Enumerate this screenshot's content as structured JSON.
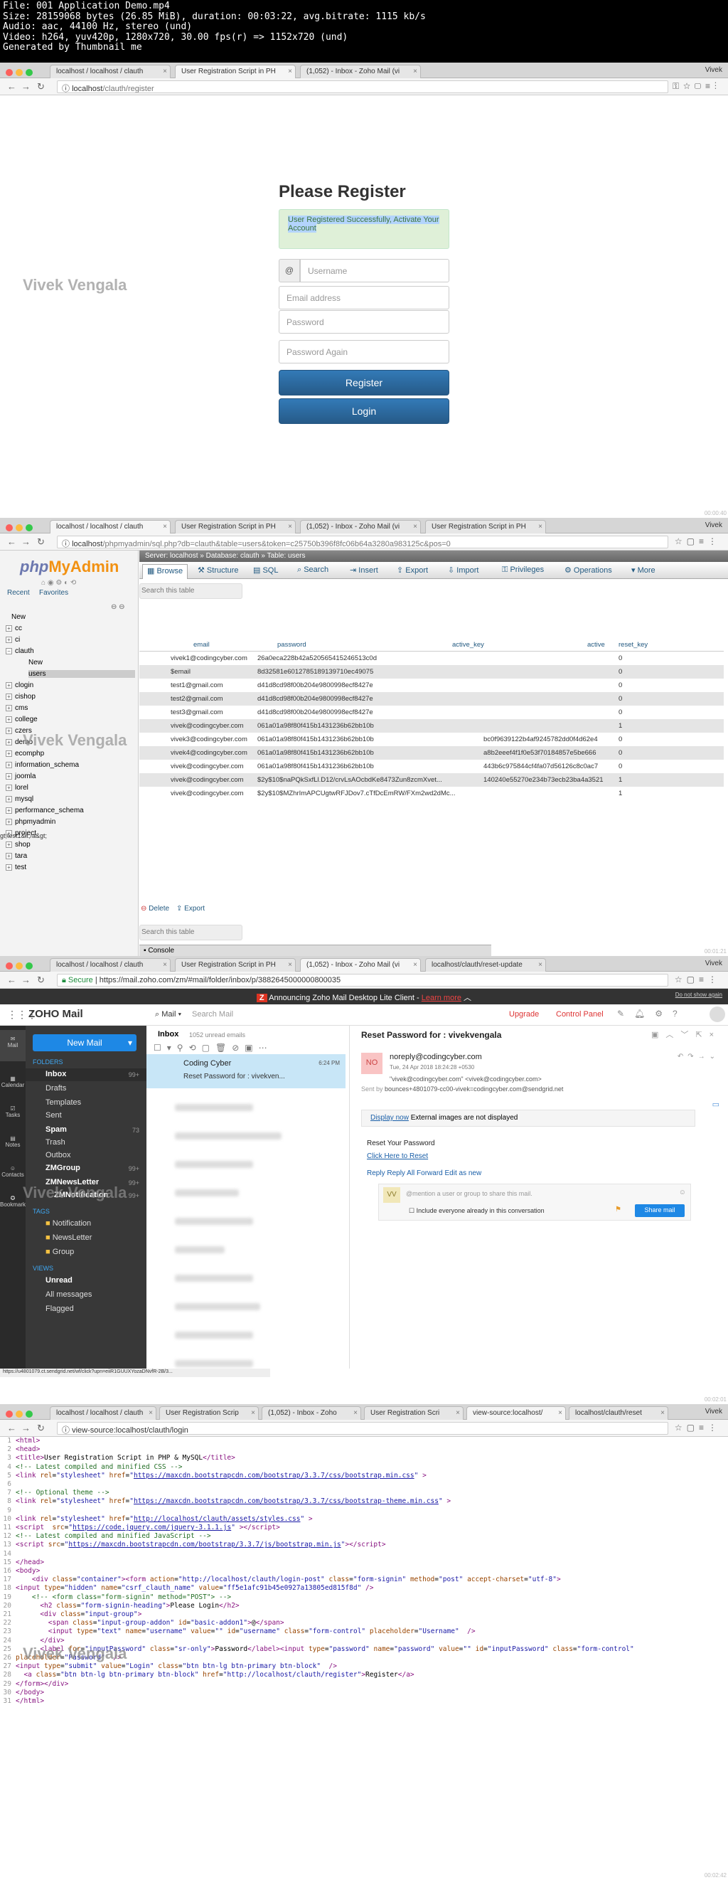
{
  "header": {
    "lines": [
      "File: 001 Application Demo.mp4",
      "Size: 28159068 bytes (26.85 MiB), duration: 00:03:22, avg.bitrate: 1115 kb/s",
      "Audio: aac, 44100 Hz, stereo (und)",
      "Video: h264, yuv420p, 1280x720, 30.00 fps(r) => 1152x720 (und)",
      "Generated by Thumbnail me"
    ]
  },
  "watermark": "Vivek Vengala",
  "user_name": "Vivek",
  "frame1": {
    "tabs": [
      "localhost / localhost / clauth",
      "User Registration Script in PH",
      "(1,052) - Inbox - Zoho Mail (vi"
    ],
    "url_host": "localhost",
    "url_path": "/clauth/register",
    "title": "Please Register",
    "alert": "User Registered Successfully, Activate Your Account",
    "addon": "@",
    "placeholders": {
      "username": "Username",
      "email": "Email address",
      "password": "Password",
      "password_again": "Password Again"
    },
    "register_btn": "Register",
    "login_btn": "Login",
    "timestamp": "00:00:40"
  },
  "frame2": {
    "tabs": [
      "localhost / localhost / clauth",
      "User Registration Script in PH",
      "(1,052) - Inbox - Zoho Mail (vi",
      "User Registration Script in PH"
    ],
    "url_host": "localhost",
    "url_path": "/phpmyadmin/sql.php?db=clauth&table=users&token=c25750b396f8fc06b64a3280a983125c&pos=0",
    "logo_php": "php",
    "logo_my": "MyAdmin",
    "recent": "Recent",
    "favorites": "Favorites",
    "breadcrumb": "Server: localhost »  Database: clauth »  Table: users",
    "tabs_pma": [
      "Browse",
      "Structure",
      "SQL",
      "Search",
      "Insert",
      "Export",
      "Import",
      "Privileges",
      "Operations",
      "More"
    ],
    "search_placeholder": "Search this table",
    "search_placeholder2": "Search this table",
    "databases": [
      "New",
      "cc",
      "ci",
      "clauth",
      "New",
      "users",
      "clogin",
      "cishop",
      "cms",
      "college",
      "czers",
      "demo",
      "ecomphp",
      "information_schema",
      "joomla",
      "lorel",
      "mysql",
      "performance_schema",
      "phpmyadmin",
      "project",
      "shop",
      "tara",
      "test"
    ],
    "columns": [
      "email",
      "password",
      "active_key",
      "active",
      "reset_key"
    ],
    "rows": [
      [
        "vivek1@codingcyber.com",
        "26a0eca228b42a520565415246513c0d",
        "",
        "0",
        ""
      ],
      [
        "$email",
        "8d32581e6012785189139710ec49075",
        "",
        "0",
        ""
      ],
      [
        "test1@gmail.com",
        "d41d8cd98f00b204e9800998ecf8427e",
        "",
        "0",
        ""
      ],
      [
        "test2@gmail.com",
        "d41d8cd98f00b204e9800998ecf8427e",
        "",
        "0",
        ""
      ],
      [
        "test3@gmail.com",
        "d41d8cd98f00b204e9800998ecf8427e",
        "",
        "0",
        ""
      ],
      [
        "vivek@codingcyber.com",
        "061a01a98f80f415b1431236b62bb10b",
        "",
        "1",
        ""
      ],
      [
        "vivek3@codingcyber.com",
        "061a01a98f80f415b1431236b62bb10b",
        "bc0f9639122b4af9245782dd0f4d62e4",
        "0",
        ""
      ],
      [
        "vivek4@codingcyber.com",
        "061a01a98f80f415b1431236b62bb10b",
        "a8b2eeef4f1f0e53f70184857e5be666",
        "0",
        ""
      ],
      [
        "vivek@codingcyber.com",
        "061a01a98f80f415b1431236b62bb10b",
        "443b6c975844cf4fa07d56126c8c0ac7",
        "0",
        ""
      ],
      [
        "vivek@codingcyber.com",
        "$2y$10$naPQkSxfLl.D12/crvLsAOcbdKe8473Zun8zcmXvet...",
        "140240e55270e234b73ecb23ba4a3521",
        "1",
        ""
      ],
      [
        "vivek@codingcyber.com",
        "$2y$10$MZhrImAPCUgtwRFJDov7.cTfDcEmRW/FXm2wd2dMc...",
        "",
        "1",
        ""
      ]
    ],
    "left_fragment": "gt;test1&lt;/a&gt;",
    "delete": "Delete",
    "export": "Export",
    "console": "Console",
    "timestamp": "00:01:21"
  },
  "frame3": {
    "tabs": [
      "localhost / localhost / clauth",
      "User Registration Script in PH",
      "(1,052) - Inbox - Zoho Mail (vi",
      "localhost/clauth/reset-update"
    ],
    "url_secure": "Secure",
    "url_path": "https://mail.zoho.com/zm/#mail/folder/inbox/p/3882645000000800035",
    "banner": "Announcing Zoho Mail Desktop Lite Client -",
    "banner_link": "Learn more",
    "banner_right": "Do not show again",
    "brand": "ZOHO Mail",
    "mail_menu": "Mail",
    "search": "Search Mail",
    "upgrade": "Upgrade",
    "control_panel": "Control Panel",
    "new_mail": "New Mail",
    "folders_title": "FOLDERS",
    "folders": [
      {
        "name": "Inbox",
        "count": "99+"
      },
      {
        "name": "Drafts",
        "count": ""
      },
      {
        "name": "Templates",
        "count": ""
      },
      {
        "name": "Sent",
        "count": ""
      },
      {
        "name": "Spam",
        "count": "73"
      },
      {
        "name": "Trash",
        "count": ""
      },
      {
        "name": "Outbox",
        "count": ""
      },
      {
        "name": "ZMGroup",
        "count": "99+"
      },
      {
        "name": "ZMNewsLetter",
        "count": "99+"
      },
      {
        "name": "ZMNotification",
        "count": "99+"
      }
    ],
    "tags_title": "TAGS",
    "tags": [
      "Notification",
      "NewsLetter",
      "Group"
    ],
    "views_title": "VIEWS",
    "views": [
      "Unread",
      "All messages",
      "Flagged"
    ],
    "left_nav": [
      "Mail",
      "Calendar",
      "Tasks",
      "Notes",
      "Contacts",
      "Bookmarks"
    ],
    "inbox_label": "Inbox",
    "unread": "1052 unread emails",
    "list_sender": "Coding Cyber",
    "list_time": "6:24 PM",
    "list_subject": "Reset Password for : vivekven...",
    "subject": "Reset Password for : vivekvengala",
    "avatar": "NO",
    "from": "noreply@codingcyber.com",
    "date": "Tue, 24 Apr 2018 18:24:28 +0530",
    "to": "\"vivek@codingcyber.com\" <vivek@codingcyber.com>",
    "sent_by_label": "Sent by",
    "sent_by": "bounces+4801079-cc00-vivek=codingcyber.com@sendgrid.net",
    "display_now": "Display now",
    "external_images": "External images are not displayed",
    "body_title": "Reset Your Password",
    "body_link": "Click Here to Reset",
    "actions": [
      "Reply",
      "Reply All",
      "Forward",
      "Edit as new"
    ],
    "reply_avatar": "VV",
    "mention_placeholder": "@mention a user or group to share this mail.",
    "include_everyone": "Include everyone already in this conversation",
    "share_mail": "Share mail",
    "status_url": "https://u4801079.ct.sendgrid.net/wf/click?upn=eiiR1GUUXYozaDNvfR-2B/3...",
    "timestamp": "00:02:01"
  },
  "frame4": {
    "tabs": [
      "localhost / localhost / clauth",
      "User Registration Scrip",
      "(1,052) - Inbox - Zoho",
      "User Registration Scri",
      "view-source:localhost/",
      "localhost/clauth/reset"
    ],
    "url_path": "view-source:localhost/clauth/login",
    "timestamp": "00:02:42"
  }
}
